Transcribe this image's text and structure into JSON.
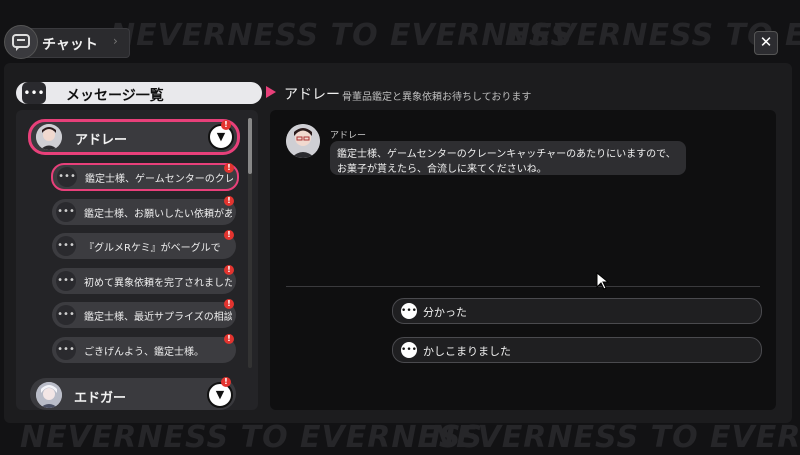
{
  "header": {
    "tab_label": "チャット",
    "close_label": "✕",
    "watermark": "NEVERNESS TO EVERNESS"
  },
  "sidebar": {
    "title": "メッセージ一覧",
    "contacts": [
      {
        "name": "アドレー",
        "expanded": true,
        "unread": true,
        "messages": [
          {
            "text": "鑑定士様、ゲームセンターのクレーンキャッチャーの",
            "unread": true
          },
          {
            "text": "鑑定士様、お願いしたい依頼があります",
            "unread": true
          },
          {
            "text": "『グルメRケミ』がベーグルで",
            "unread": true
          },
          {
            "text": "初めて異象依頼を完了されました",
            "unread": true
          },
          {
            "text": "鑑定士様、最近サプライズの相談",
            "unread": true
          },
          {
            "text": "ごきげんよう、鑑定士様。",
            "unread": true
          }
        ]
      },
      {
        "name": "エドガー",
        "expanded": false,
        "unread": true
      }
    ]
  },
  "conversation": {
    "title": "アドレー",
    "subtitle": "骨董品鑑定と異象依頼お待ちしております",
    "sender": "アドレー",
    "message": "鑑定士様、ゲームセンターのクレーンキャッチャーのあたりにいますので、お菓子が貰えたら、合流しに来てくださいね。",
    "replies": [
      "分かった",
      "かしこまりました"
    ]
  },
  "colors": {
    "accent": "#e8407a",
    "badge": "#e3342f"
  }
}
